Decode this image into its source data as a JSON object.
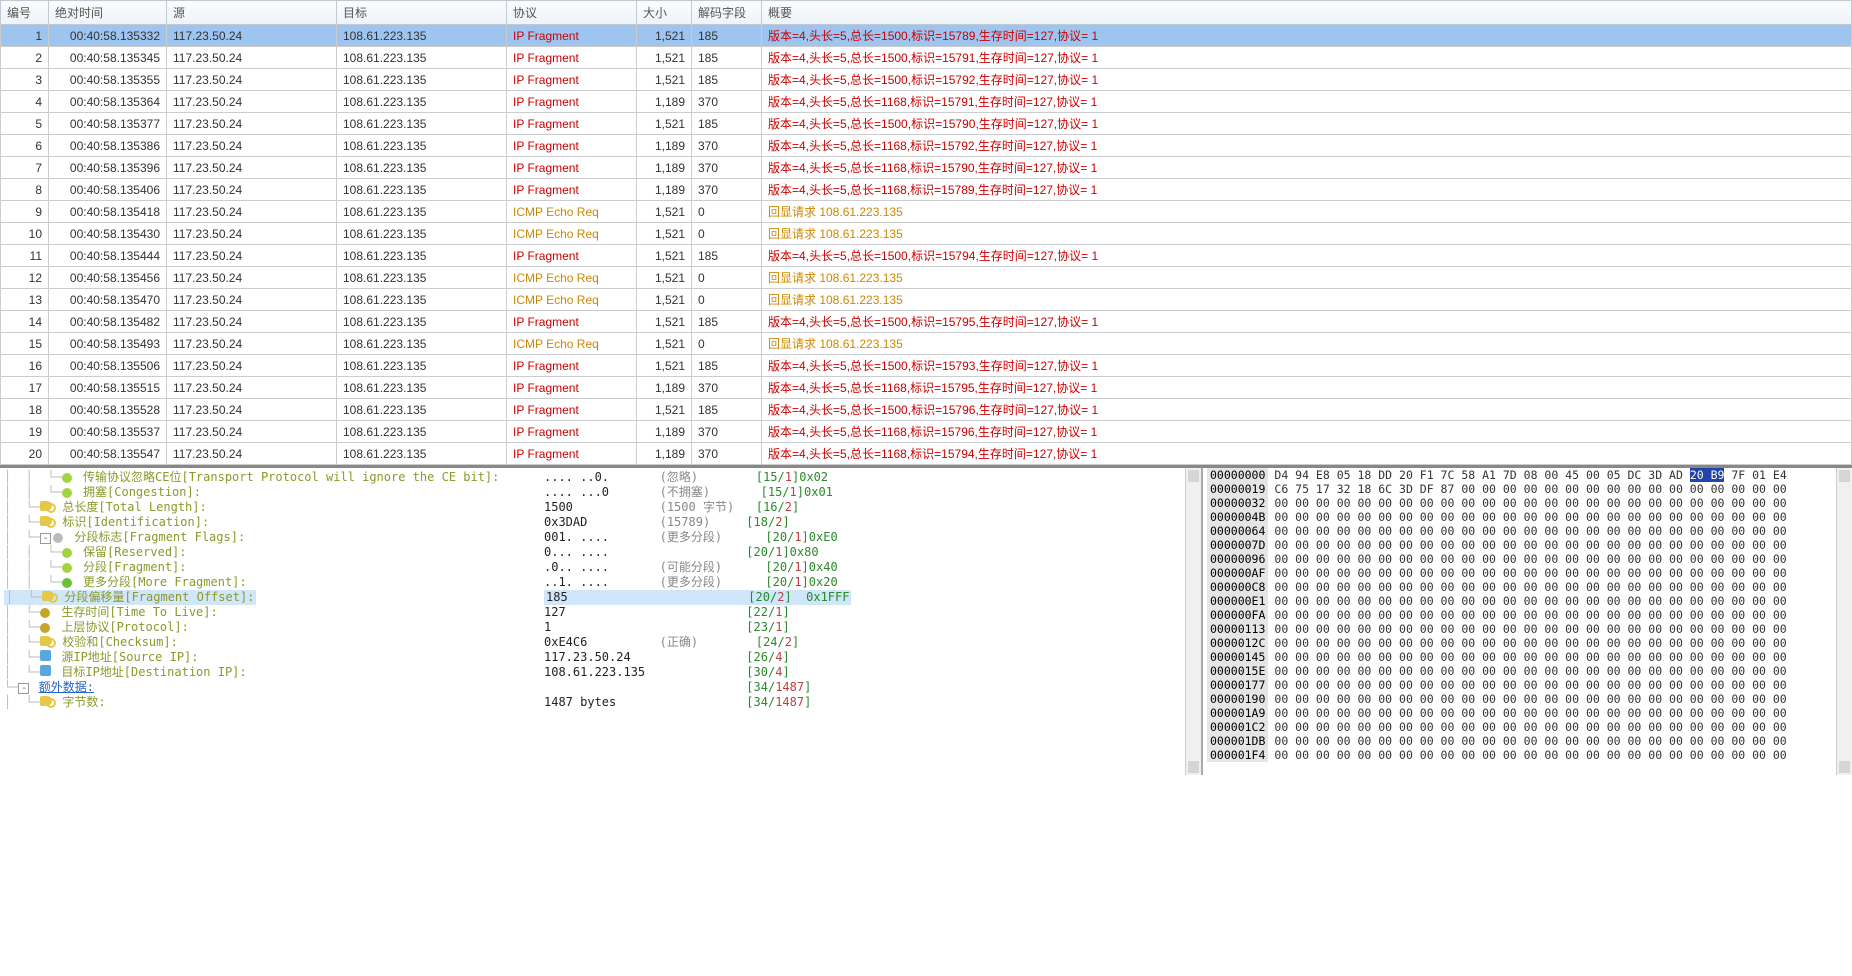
{
  "columns": {
    "no": "编号",
    "time": "绝对时间",
    "src": "源",
    "dst": "目标",
    "proto": "协议",
    "size": "大小",
    "decode": "解码字段",
    "summary": "概要"
  },
  "protocols": {
    "ipfrag": "IP Fragment",
    "icmp": "ICMP Echo Req"
  },
  "summaries": {
    "ipfrag_prefix": "版本=4,头长=5,总长=",
    "ipfrag_mid1": ",标识=",
    "ipfrag_mid2": ",生存时间=127,协议=  1",
    "icmp": "回显请求 108.61.223.135"
  },
  "packets": [
    {
      "no": 1,
      "time": "00:40:58.135332",
      "src": "117.23.50.24",
      "dst": "108.61.223.135",
      "proto": "ipfrag",
      "size": "1,521",
      "decode": "185",
      "totlen": 1500,
      "id": 15789,
      "sel": true
    },
    {
      "no": 2,
      "time": "00:40:58.135345",
      "src": "117.23.50.24",
      "dst": "108.61.223.135",
      "proto": "ipfrag",
      "size": "1,521",
      "decode": "185",
      "totlen": 1500,
      "id": 15791
    },
    {
      "no": 3,
      "time": "00:40:58.135355",
      "src": "117.23.50.24",
      "dst": "108.61.223.135",
      "proto": "ipfrag",
      "size": "1,521",
      "decode": "185",
      "totlen": 1500,
      "id": 15792
    },
    {
      "no": 4,
      "time": "00:40:58.135364",
      "src": "117.23.50.24",
      "dst": "108.61.223.135",
      "proto": "ipfrag",
      "size": "1,189",
      "decode": "370",
      "totlen": 1168,
      "id": 15791
    },
    {
      "no": 5,
      "time": "00:40:58.135377",
      "src": "117.23.50.24",
      "dst": "108.61.223.135",
      "proto": "ipfrag",
      "size": "1,521",
      "decode": "185",
      "totlen": 1500,
      "id": 15790
    },
    {
      "no": 6,
      "time": "00:40:58.135386",
      "src": "117.23.50.24",
      "dst": "108.61.223.135",
      "proto": "ipfrag",
      "size": "1,189",
      "decode": "370",
      "totlen": 1168,
      "id": 15792
    },
    {
      "no": 7,
      "time": "00:40:58.135396",
      "src": "117.23.50.24",
      "dst": "108.61.223.135",
      "proto": "ipfrag",
      "size": "1,189",
      "decode": "370",
      "totlen": 1168,
      "id": 15790
    },
    {
      "no": 8,
      "time": "00:40:58.135406",
      "src": "117.23.50.24",
      "dst": "108.61.223.135",
      "proto": "ipfrag",
      "size": "1,189",
      "decode": "370",
      "totlen": 1168,
      "id": 15789
    },
    {
      "no": 9,
      "time": "00:40:58.135418",
      "src": "117.23.50.24",
      "dst": "108.61.223.135",
      "proto": "icmp",
      "size": "1,521",
      "decode": "0"
    },
    {
      "no": 10,
      "time": "00:40:58.135430",
      "src": "117.23.50.24",
      "dst": "108.61.223.135",
      "proto": "icmp",
      "size": "1,521",
      "decode": "0"
    },
    {
      "no": 11,
      "time": "00:40:58.135444",
      "src": "117.23.50.24",
      "dst": "108.61.223.135",
      "proto": "ipfrag",
      "size": "1,521",
      "decode": "185",
      "totlen": 1500,
      "id": 15794
    },
    {
      "no": 12,
      "time": "00:40:58.135456",
      "src": "117.23.50.24",
      "dst": "108.61.223.135",
      "proto": "icmp",
      "size": "1,521",
      "decode": "0"
    },
    {
      "no": 13,
      "time": "00:40:58.135470",
      "src": "117.23.50.24",
      "dst": "108.61.223.135",
      "proto": "icmp",
      "size": "1,521",
      "decode": "0"
    },
    {
      "no": 14,
      "time": "00:40:58.135482",
      "src": "117.23.50.24",
      "dst": "108.61.223.135",
      "proto": "ipfrag",
      "size": "1,521",
      "decode": "185",
      "totlen": 1500,
      "id": 15795
    },
    {
      "no": 15,
      "time": "00:40:58.135493",
      "src": "117.23.50.24",
      "dst": "108.61.223.135",
      "proto": "icmp",
      "size": "1,521",
      "decode": "0"
    },
    {
      "no": 16,
      "time": "00:40:58.135506",
      "src": "117.23.50.24",
      "dst": "108.61.223.135",
      "proto": "ipfrag",
      "size": "1,521",
      "decode": "185",
      "totlen": 1500,
      "id": 15793
    },
    {
      "no": 17,
      "time": "00:40:58.135515",
      "src": "117.23.50.24",
      "dst": "108.61.223.135",
      "proto": "ipfrag",
      "size": "1,189",
      "decode": "370",
      "totlen": 1168,
      "id": 15795
    },
    {
      "no": 18,
      "time": "00:40:58.135528",
      "src": "117.23.50.24",
      "dst": "108.61.223.135",
      "proto": "ipfrag",
      "size": "1,521",
      "decode": "185",
      "totlen": 1500,
      "id": 15796
    },
    {
      "no": 19,
      "time": "00:40:58.135537",
      "src": "117.23.50.24",
      "dst": "108.61.223.135",
      "proto": "ipfrag",
      "size": "1,189",
      "decode": "370",
      "totlen": 1168,
      "id": 15796
    },
    {
      "no": 20,
      "time": "00:40:58.135547",
      "src": "117.23.50.24",
      "dst": "108.61.223.135",
      "proto": "ipfrag",
      "size": "1,189",
      "decode": "370",
      "totlen": 1168,
      "id": 15794
    }
  ],
  "tree": [
    {
      "indent": 3,
      "icon": "lime",
      "label": "传输协议忽略CE位[Transport Protocol will ignore the CE bit]:",
      "val": ".... ..0.",
      "hint": "(忽略)",
      "pos": "[15/1]",
      "hex": "0x02"
    },
    {
      "indent": 3,
      "icon": "lime",
      "label": "拥塞[Congestion]:",
      "val": ".... ...0",
      "hint": "(不拥塞)",
      "pos": "[15/1]",
      "hex": "0x01"
    },
    {
      "indent": 2,
      "icon": "key",
      "label": "总长度[Total Length]:",
      "val": "1500",
      "hint": "(1500 字节)",
      "pos": "[16/2]"
    },
    {
      "indent": 2,
      "icon": "key",
      "label": "标识[Identification]:",
      "val": "0x3DAD",
      "hint": "(15789)",
      "pos": "[18/2]"
    },
    {
      "indent": 2,
      "icon": "gray",
      "exp": "-",
      "label": "分段标志[Fragment Flags]:",
      "val": "001. ....",
      "hint": "(更多分段)",
      "pos": "[20/1]",
      "hex": "0xE0"
    },
    {
      "indent": 3,
      "icon": "lime",
      "label": "保留[Reserved]:",
      "val": "0... ....",
      "hint": "",
      "pos": "[20/1]",
      "hex": "0x80"
    },
    {
      "indent": 3,
      "icon": "lime",
      "label": "分段[Fragment]:",
      "val": ".0.. ....",
      "hint": "(可能分段)",
      "pos": "[20/1]",
      "hex": "0x40"
    },
    {
      "indent": 3,
      "icon": "green",
      "label": "更多分段[More Fragment]:",
      "val": "..1. ....",
      "hint": "(更多分段)",
      "pos": "[20/1]",
      "hex": "0x20"
    },
    {
      "indent": 2,
      "icon": "key",
      "label": "分段偏移量[Fragment Offset]:",
      "val": "185",
      "hint": "",
      "pos": "[20/2]",
      "hex": "0x1FFF",
      "hl": true
    },
    {
      "indent": 2,
      "icon": "darkyellow",
      "label": "生存时间[Time To Live]:",
      "val": "127",
      "hint": "",
      "pos": "[22/1]"
    },
    {
      "indent": 2,
      "icon": "darkyellow",
      "label": "上层协议[Protocol]:",
      "val": "1",
      "hint": "",
      "pos": "[23/1]"
    },
    {
      "indent": 2,
      "icon": "key",
      "label": "校验和[Checksum]:",
      "val": "0xE4C6",
      "hint": "(正确)",
      "pos": "[24/2]"
    },
    {
      "indent": 2,
      "icon": "iface",
      "label": "源IP地址[Source IP]:",
      "val": "117.23.50.24",
      "hint": "",
      "pos": "[26/4]"
    },
    {
      "indent": 2,
      "icon": "iface",
      "label": "目标IP地址[Destination IP]:",
      "val": "108.61.223.135",
      "hint": "",
      "pos": "[30/4]"
    },
    {
      "indent": 1,
      "exp": "-",
      "link": true,
      "label": "额外数据:",
      "val": "",
      "hint": "",
      "pos": "[34/1487]"
    },
    {
      "indent": 2,
      "icon": "key",
      "label": "字节数:",
      "val": "1487 bytes",
      "hint": "",
      "pos": "[34/1487]"
    }
  ],
  "hex": {
    "offsets": [
      "00000000",
      "00000019",
      "00000032",
      "0000004B",
      "00000064",
      "0000007D",
      "00000096",
      "000000AF",
      "000000C8",
      "000000E1",
      "000000FA",
      "00000113",
      "0000012C",
      "00000145",
      "0000015E",
      "00000177",
      "00000190",
      "000001A9",
      "000001C2",
      "000001DB",
      "000001F4"
    ],
    "first_line_pre": "D4 94 E8 05 18 DD 20 F1 7C 58 A1 7D 08 00 45 00 05 DC 3D AD ",
    "first_line_hl": "20 B9",
    "first_line_post": " 7F 01 E4",
    "second_line": "C6 75 17 32 18 6C 3D DF 87 00 00 00 00 00 00 00 00 00 00 00 00 00 00 00 00",
    "zero_line": "00 00 00 00 00 00 00 00 00 00 00 00 00 00 00 00 00 00 00 00 00 00 00 00 00"
  }
}
